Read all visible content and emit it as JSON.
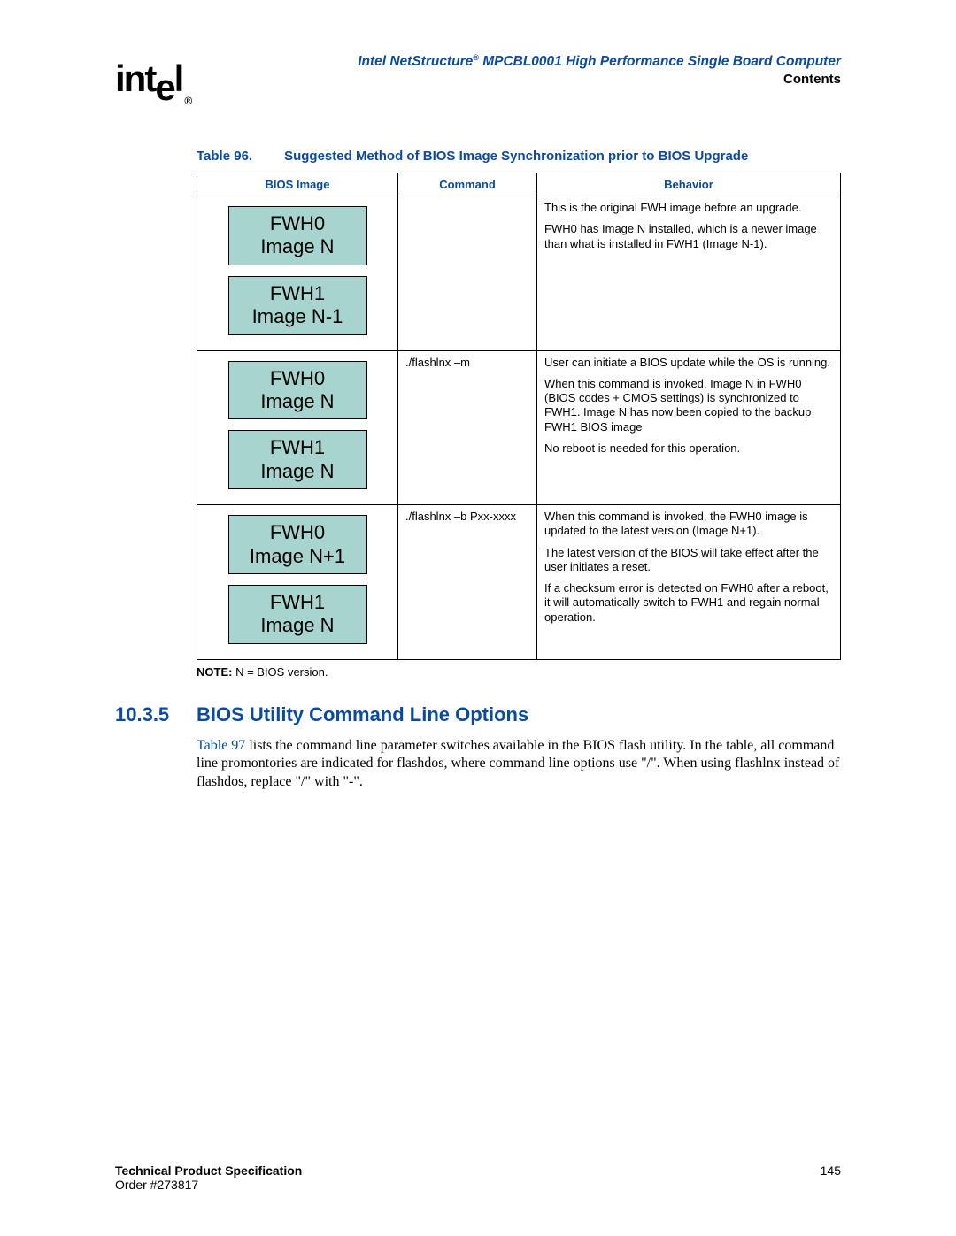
{
  "header": {
    "logo_text": "intel",
    "reg_mark": "®",
    "doc_title_prefix": "Intel NetStructure",
    "doc_title_suffix": " MPCBL0001 High Performance Single Board Computer",
    "contents_link": "Contents"
  },
  "table": {
    "caption_label": "Table 96.",
    "caption_title": "Suggested Method of BIOS Image Synchronization prior to BIOS Upgrade",
    "headers": {
      "bios_image": "BIOS Image",
      "command": "Command",
      "behavior": "Behavior"
    },
    "rows": [
      {
        "box1_line1": "FWH0",
        "box1_line2": "Image N",
        "box2_line1": "FWH1",
        "box2_line2": "Image N-1",
        "command": "",
        "behavior_p1": "This is the original FWH image before an upgrade.",
        "behavior_p2": "FWH0 has Image N installed, which is a newer image than what is installed in FWH1 (Image N-1).",
        "behavior_p3": ""
      },
      {
        "box1_line1": "FWH0",
        "box1_line2": "Image N",
        "box2_line1": "FWH1",
        "box2_line2": "Image N",
        "command": "./flashlnx –m",
        "behavior_p1": "User can initiate a BIOS update while the OS is running.",
        "behavior_p2": "When this command is invoked, Image N in FWH0 (BIOS codes + CMOS settings) is synchronized to FWH1. Image N has now been copied to the backup FWH1 BIOS image",
        "behavior_p3": "No reboot is needed for this operation."
      },
      {
        "box1_line1": "FWH0",
        "box1_line2": "Image N+1",
        "box2_line1": "FWH1",
        "box2_line2": "Image N",
        "command": "./flashlnx –b Pxx-xxxx",
        "behavior_p1": "When this command is invoked, the FWH0 image is updated to the latest version (Image N+1).",
        "behavior_p2": "The latest version of the BIOS will take effect after the user initiates a reset.",
        "behavior_p3": "If a checksum error is detected on FWH0 after a reboot, it will automatically switch to FWH1 and regain normal operation."
      }
    ],
    "note_label": "NOTE:",
    "note_text": "  N = BIOS version."
  },
  "section": {
    "number": "10.3.5",
    "title": "BIOS Utility Command Line Options",
    "xref": "Table 97",
    "para_rest": " lists the command line parameter switches available in the BIOS flash utility. In the table, all command line promontories are indicated for flashdos, where command line options use \"/\". When using flashlnx instead of flashdos, replace \"/\" with \"-\"."
  },
  "footer": {
    "spec": "Technical Product Specification",
    "order": "Order #273817",
    "page": "145"
  }
}
